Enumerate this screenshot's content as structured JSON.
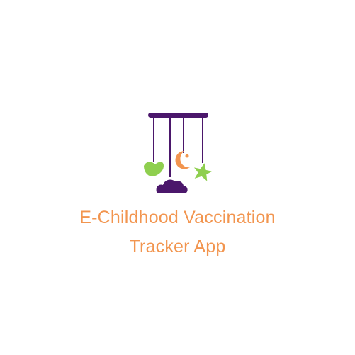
{
  "app": {
    "title_line1": "E-Childhood Vaccination",
    "title_line2": "Tracker App"
  },
  "logo": {
    "icon": "baby-mobile-icon",
    "colors": {
      "purple": "#4b176b",
      "green": "#8fcf4f",
      "orange": "#f2954f"
    }
  }
}
